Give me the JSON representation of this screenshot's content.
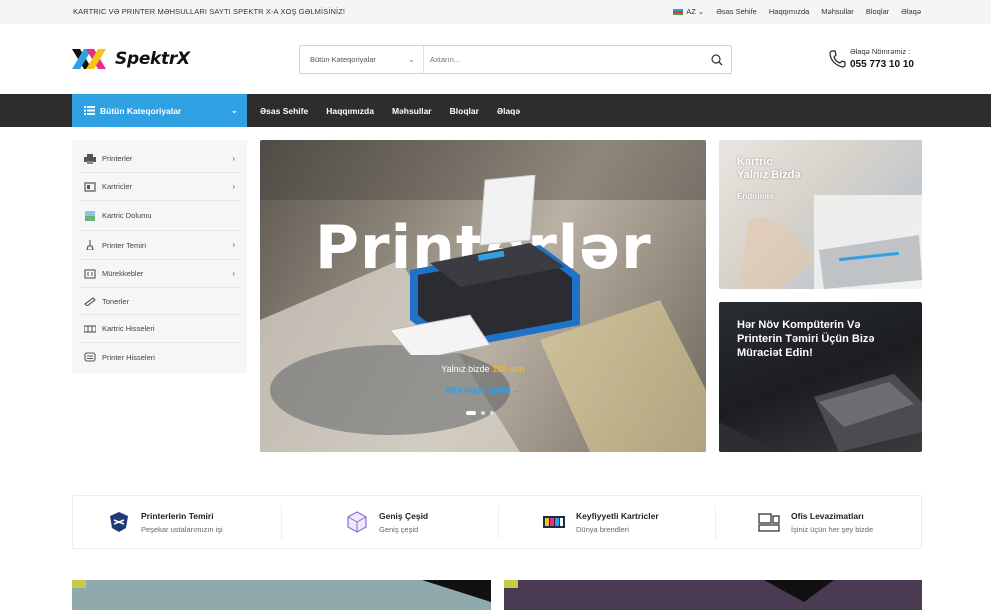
{
  "topbar": {
    "welcome": "KARTRIC VƏ PRINTER MƏHSULLARI SAYTI SPEKTR X-A XOŞ GƏLMİSİNİZ!",
    "language": "AZ",
    "links": [
      "Əsas Sehife",
      "Haqqımızda",
      "Məhsullar",
      "Bloqlar",
      "Əlaqə"
    ]
  },
  "header": {
    "logo_text": "SpektrX",
    "search": {
      "category": "Bütün Kateqoriyalar",
      "placeholder": "Axtarın..."
    },
    "contact": {
      "label": "Əlaqə Nömrəmiz :",
      "phone": "055 773 10 10"
    }
  },
  "nav": {
    "all_categories": "Bütün Kateqoriyalar",
    "links": [
      "Əsas Sehife",
      "Haqqımızda",
      "Məhsullar",
      "Bloqlar",
      "Əlaqə"
    ]
  },
  "sidebar": {
    "items": [
      {
        "label": "Printerler",
        "icon": "printer-icon",
        "has_arrow": true
      },
      {
        "label": "Kartricler",
        "icon": "cartridge-icon",
        "has_arrow": true
      },
      {
        "label": "Kartric Dolumu",
        "icon": "refill-icon",
        "has_arrow": false
      },
      {
        "label": "Printer Temiri",
        "icon": "repair-icon",
        "has_arrow": true
      },
      {
        "label": "Mürekkebler",
        "icon": "ink-icon",
        "has_arrow": true
      },
      {
        "label": "Tonerler",
        "icon": "toner-icon",
        "has_arrow": false
      },
      {
        "label": "Kartric Hisseleri",
        "icon": "cartridge-parts-icon",
        "has_arrow": false
      },
      {
        "label": "Printer Hisseleri",
        "icon": "printer-parts-icon",
        "has_arrow": false
      }
    ]
  },
  "hero": {
    "headline": "Printerlər",
    "promo_prefix": "Yalnız bizde",
    "promo_price": "100 azn",
    "cta": "İNDİ KƏŞF EDİN!",
    "slide_count": 3,
    "active_slide": 1
  },
  "banners": {
    "banner1": {
      "line1": "Kartric",
      "line2": "Yalnız Bizdə",
      "sub": "Endirimlə"
    },
    "banner2": {
      "text": "Hər Növ Kompüterin Və Printerin Təmiri Üçün Bizə Müraciət Edin!"
    }
  },
  "features": [
    {
      "title": "Printerlerin Temiri",
      "subtitle": "Peşekar ustalarımızın işi",
      "icon": "repair-shield-icon"
    },
    {
      "title": "Geniş Çeşid",
      "subtitle": "Geniş çeşid",
      "icon": "cube-icon"
    },
    {
      "title": "Keyfiyyetli Kartricler",
      "subtitle": "Dünya brendleri",
      "icon": "cartridges-icon"
    },
    {
      "title": "Ofis Levazimatları",
      "subtitle": "İşiniz üçün her şey bizde",
      "icon": "office-supplies-icon"
    }
  ],
  "colors": {
    "accent": "#2fa1e3",
    "nav_bg": "#2d2d2d",
    "promo": "#f5b51b"
  }
}
